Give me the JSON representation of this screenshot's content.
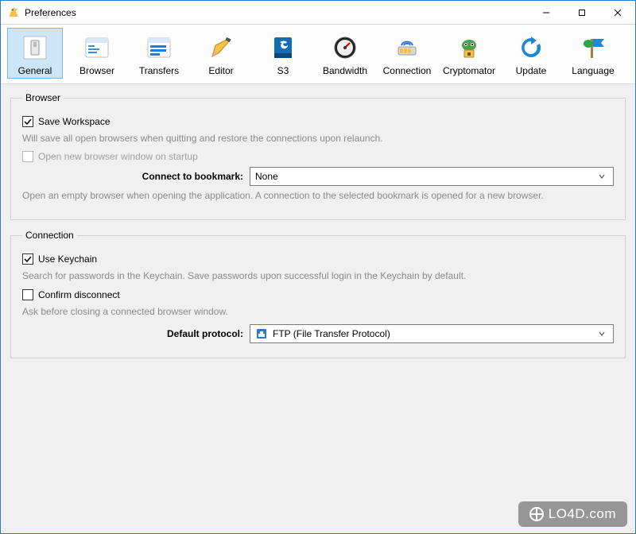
{
  "window": {
    "title": "Preferences"
  },
  "toolbar": {
    "items": [
      {
        "label": "General"
      },
      {
        "label": "Browser"
      },
      {
        "label": "Transfers"
      },
      {
        "label": "Editor"
      },
      {
        "label": "S3"
      },
      {
        "label": "Bandwidth"
      },
      {
        "label": "Connection"
      },
      {
        "label": "Cryptomator"
      },
      {
        "label": "Update"
      },
      {
        "label": "Language"
      }
    ],
    "selected_index": 0
  },
  "groups": {
    "browser": {
      "legend": "Browser",
      "save_workspace": {
        "label": "Save Workspace",
        "checked": true,
        "desc": "Will save all open browsers when quitting and restore the connections upon relaunch."
      },
      "open_new_window": {
        "label": "Open new browser window on startup",
        "checked": false,
        "disabled": true
      },
      "connect_bookmark": {
        "label": "Connect to bookmark:",
        "value": "None",
        "desc": "Open an empty browser when opening the application. A connection to the selected bookmark is opened for a new browser."
      }
    },
    "connection": {
      "legend": "Connection",
      "use_keychain": {
        "label": "Use Keychain",
        "checked": true,
        "desc": "Search for passwords in the Keychain. Save passwords upon successful login in the Keychain by default."
      },
      "confirm_disconnect": {
        "label": "Confirm disconnect",
        "checked": false,
        "desc": "Ask before closing a connected browser window."
      },
      "default_protocol": {
        "label": "Default protocol:",
        "value": "FTP (File Transfer Protocol)"
      }
    }
  },
  "watermark": "LO4D.com"
}
